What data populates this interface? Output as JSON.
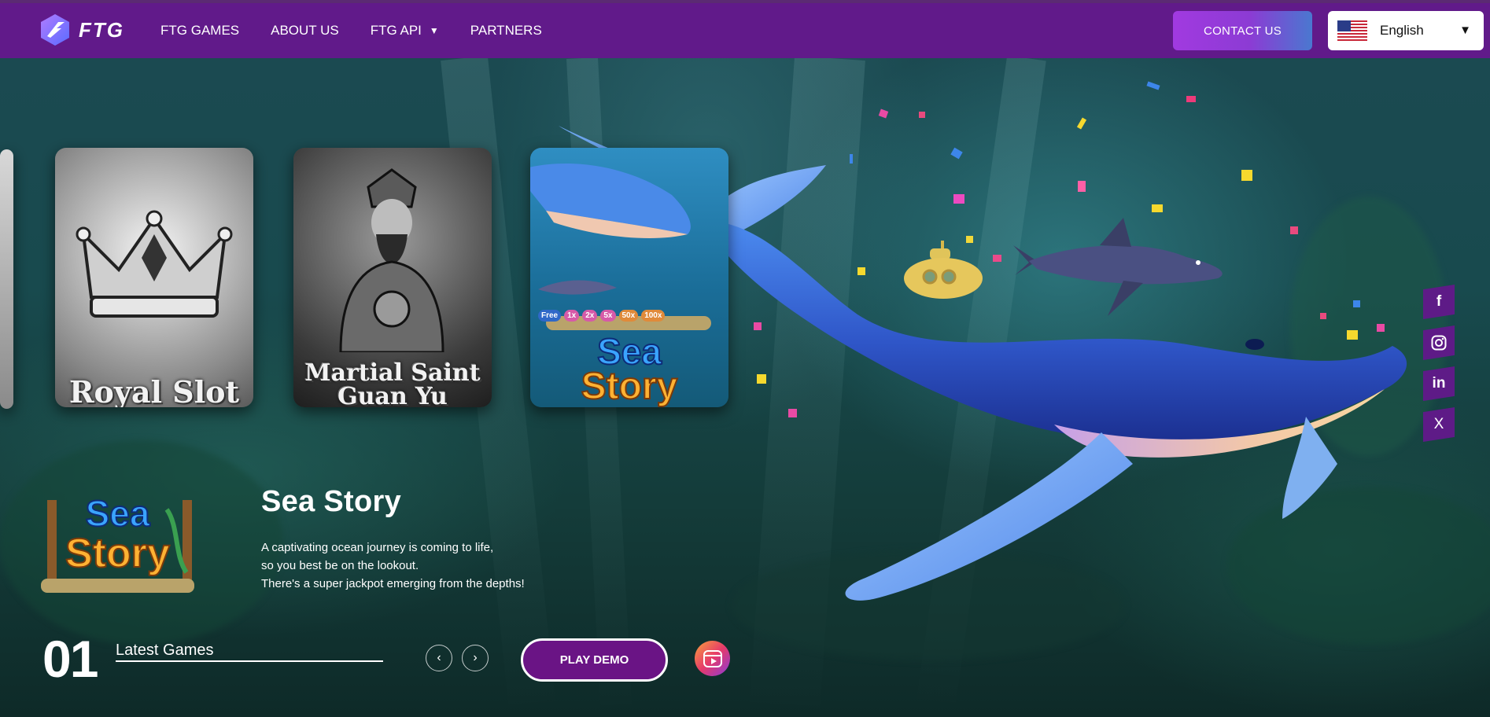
{
  "nav": {
    "logo_text": "FTG",
    "links": [
      {
        "label": "FTG GAMES"
      },
      {
        "label": "ABOUT US"
      },
      {
        "label": "FTG API",
        "has_dropdown": true
      },
      {
        "label": "PARTNERS"
      }
    ],
    "contact_label": "CONTACT US",
    "language": "English"
  },
  "cards": [
    {
      "label_line1": "Royal Slot",
      "label_line2": ""
    },
    {
      "label_line1": "Martial Saint",
      "label_line2": "Guan Yu"
    },
    {
      "label_line1": "Sea",
      "label_line2": "Story"
    }
  ],
  "featured": {
    "logo_line1": "Sea",
    "logo_line2": "Story",
    "title": "Sea Story",
    "description": [
      "A captivating ocean journey is coming to life,",
      "so you best be on the lookout.",
      "There's a super jackpot emerging from the depths!"
    ],
    "multipliers": [
      "Free",
      "1x",
      "2x",
      "5x",
      "50x",
      "100x"
    ]
  },
  "slider": {
    "index": "01",
    "section_label": "Latest Games",
    "prev_glyph": "‹",
    "next_glyph": "›",
    "play_label": "PLAY DEMO"
  },
  "social": [
    {
      "icon": "facebook-icon",
      "glyph": "f"
    },
    {
      "icon": "instagram-icon",
      "glyph": ""
    },
    {
      "icon": "linkedin-icon",
      "glyph": "in"
    },
    {
      "icon": "x-icon",
      "glyph": "X"
    }
  ],
  "colors": {
    "nav_bg": "#611a8a",
    "accent": "#a13ae0",
    "play_bg": "#6a1485"
  }
}
